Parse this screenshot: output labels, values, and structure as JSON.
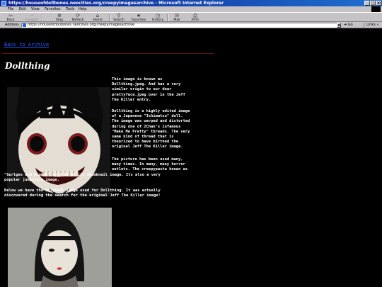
{
  "window": {
    "title": "https://houseofdollbones.neocities.org/creepyimagesarchive - Microsoft Internet Explorer"
  },
  "menu": [
    "File",
    "Edit",
    "View",
    "Favorites",
    "Tools",
    "Help"
  ],
  "toolbar": {
    "buttons": [
      "Back",
      "Forward",
      "Stop",
      "Refresh",
      "Home",
      "Search",
      "Favorites",
      "History",
      "Mail",
      "Print"
    ]
  },
  "address": {
    "label": "Address",
    "url": "https://houseofdollbones.neocities.org/creepyimagesarchive",
    "go": "Go",
    "links": "Links"
  },
  "page": {
    "back_link": "Back to Archive",
    "title": "Dollthing",
    "p1": "This image is known as\nDollthing.jpeg. And has a very\nsimilar origin to our dear\nprettyface.jpeg over in the Jeff\nThe Killer entry.",
    "p2": "Dollthing is a highly edited image\nof a Japanese \"Ichimatsu\" doll.\nThe image was warped and distorted\nduring one of 2Chan's infamous\n\"Make Me Pretty\" threads. The very\nsame kind of thread that is\ntheorized to have birthed the\noriginal Jeff The Killer image.",
    "p3a": "The picture has been used many,\nmany times. In many, many horror\noutlets. The creepypasta known as",
    "p3b": "\"Gurlges and Bugman\" used it as its thumbnail image. Its also a very\npopular jumpscare image.",
    "p4": "Below we have the original image used for Dollthing. It was actually\ndiscovered during the search for the original Jeff The Killer image!"
  }
}
